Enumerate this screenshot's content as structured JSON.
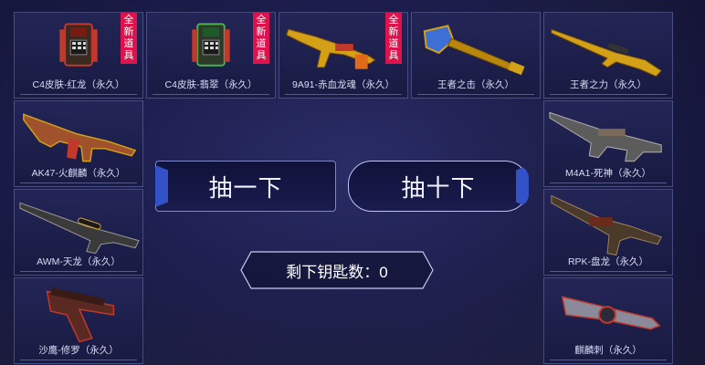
{
  "items": [
    {
      "name": "C4皮肤-红龙（永久）",
      "icon": "c4-bomb-red-icon",
      "new_badge": [
        "全",
        "新",
        "道",
        "具"
      ]
    },
    {
      "name": "C4皮肤-翡翠（永久）",
      "icon": "c4-bomb-jade-icon",
      "new_badge": [
        "全",
        "新",
        "道",
        "具"
      ]
    },
    {
      "name": "9A91-赤血龙魂（永久）",
      "icon": "rifle-9a91-icon",
      "new_badge": [
        "全",
        "新",
        "道",
        "具"
      ]
    },
    {
      "name": "王者之击（永久）",
      "icon": "shovel-icon",
      "new_badge": null
    },
    {
      "name": "王者之力（永久）",
      "icon": "sniper-rifle-gold-icon",
      "new_badge": null
    },
    {
      "name": "AK47-火麒麟（永久）",
      "icon": "ak47-icon",
      "new_badge": null
    },
    {
      "name": "M4A1-死神（永久）",
      "icon": "m4a1-icon",
      "new_badge": null
    },
    {
      "name": "AWM-天龙（永久）",
      "icon": "awm-sniper-icon",
      "new_badge": null
    },
    {
      "name": "RPK-盘龙（永久）",
      "icon": "rpk-machine-gun-icon",
      "new_badge": null
    },
    {
      "name": "沙鹰-修罗（永久）",
      "icon": "desert-eagle-icon",
      "new_badge": null
    },
    {
      "name": "麒麟刺（永久）",
      "icon": "knife-qilin-icon",
      "new_badge": null
    }
  ],
  "buttons": {
    "draw_one": "抽一下",
    "draw_ten": "抽十下"
  },
  "keys": {
    "label": "剩下钥匙数：0"
  }
}
